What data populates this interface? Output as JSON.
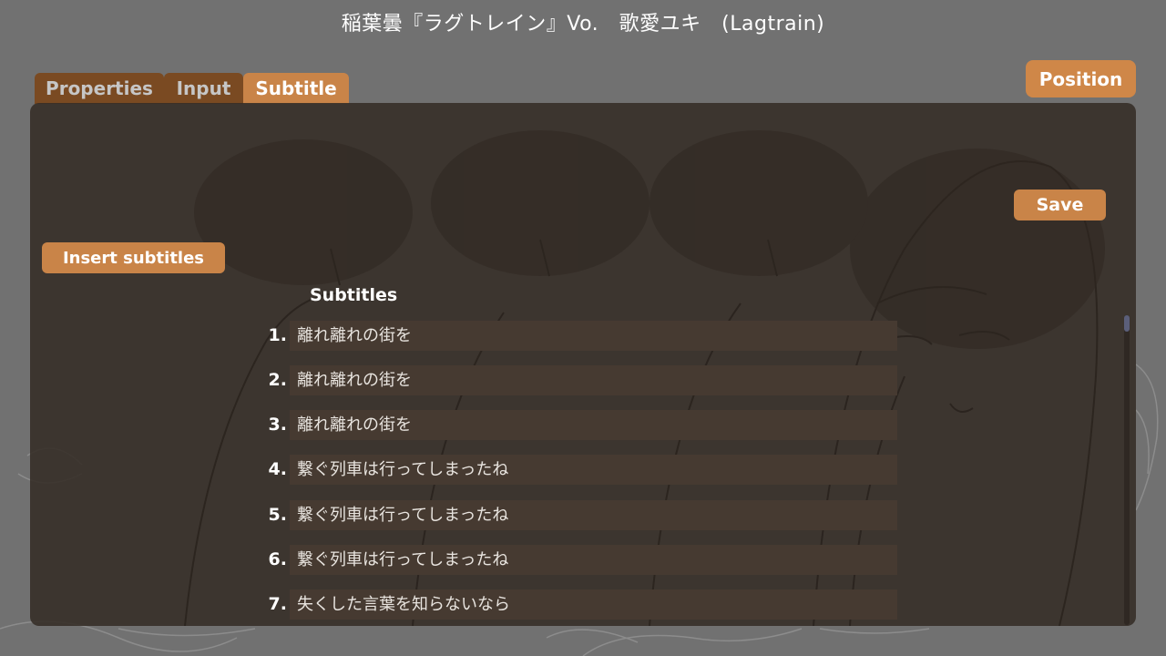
{
  "window": {
    "title": "稲葉曇『ラグトレイン』Vo.　歌愛ユキ　(Lagtrain)"
  },
  "tabs": [
    {
      "label": "Properties",
      "active": false
    },
    {
      "label": "Input",
      "active": false
    },
    {
      "label": "Subtitle",
      "active": true
    }
  ],
  "header": {
    "position_label": "Position"
  },
  "panel": {
    "save_label": "Save",
    "insert_label": "Insert subtitles",
    "subtitles_heading": "Subtitles"
  },
  "subtitles": [
    {
      "num": "1.",
      "text": "離れ離れの街を"
    },
    {
      "num": "2.",
      "text": "離れ離れの街を"
    },
    {
      "num": "3.",
      "text": "離れ離れの街を"
    },
    {
      "num": "4.",
      "text": "繋ぐ列車は行ってしまったね"
    },
    {
      "num": "5.",
      "text": "繋ぐ列車は行ってしまったね"
    },
    {
      "num": "6.",
      "text": "繋ぐ列車は行ってしまったね"
    },
    {
      "num": "7.",
      "text": "失くした言葉を知らないなら"
    }
  ],
  "colors": {
    "background": "#717171",
    "panel": "#342c25",
    "accent": "#c98448",
    "tab_inactive": "#7a4a22",
    "field": "#463a31"
  }
}
